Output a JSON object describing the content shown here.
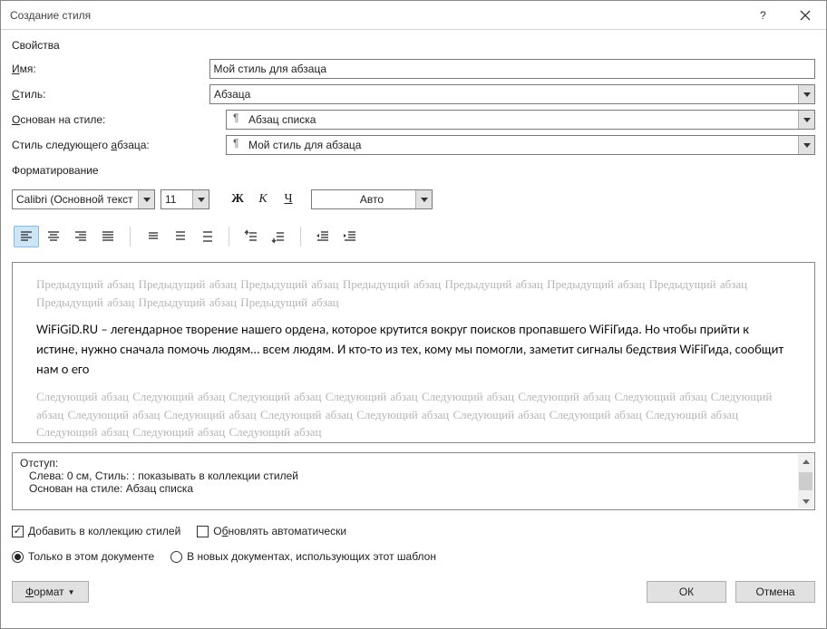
{
  "titlebar": {
    "title": "Создание стиля"
  },
  "properties": {
    "section_label": "Свойства",
    "name_label": "Имя:",
    "name_underline": "И",
    "name_value": "Мой стиль для абзаца",
    "type_label": "Стиль:",
    "type_underline": "С",
    "type_value": "Абзаца",
    "based_label": "Основан на стиле:",
    "based_underline": "О",
    "based_value": "Абзац списка",
    "next_label": "Стиль следующего абзаца:",
    "next_underline_part": "а",
    "next_value": "Мой стиль для абзаца"
  },
  "formatting": {
    "section_label": "Форматирование",
    "font_name": "Calibri (Основной текст",
    "font_size": "11",
    "bold_label": "Ж",
    "italic_label": "К",
    "underline_label": "Ч",
    "color_label": "Авто"
  },
  "preview": {
    "prev_unit": "Предыдущий абзац",
    "next_unit": "Следующий абзац",
    "sample": "WiFiGiD.RU – легендарное творение нашего ордена, которое крутится вокруг поисков пропавшего WiFiГида. Но чтобы прийти к истине, нужно сначала помочь людям… всем людям. И кто-то из тех, кому мы помогли, заметит сигналы бедствия WiFiГида, сообщит нам о его"
  },
  "description": {
    "line1": "Отступ:",
    "line2": "Слева:  0 см, Стиль: : показывать в коллекции стилей",
    "line3": "Основан на стиле: Абзац списка"
  },
  "options": {
    "add_collection": "Добавить в коллекцию стилей",
    "add_underline": "Д",
    "auto_update": "Обновлять автоматически",
    "auto_underline": "б",
    "only_this": "Только в этом документе",
    "new_docs": "В новых документах, использующих этот шаблон"
  },
  "buttons": {
    "format": "Формат",
    "format_underline": "Ф",
    "ok": "ОК",
    "cancel": "Отмена"
  }
}
